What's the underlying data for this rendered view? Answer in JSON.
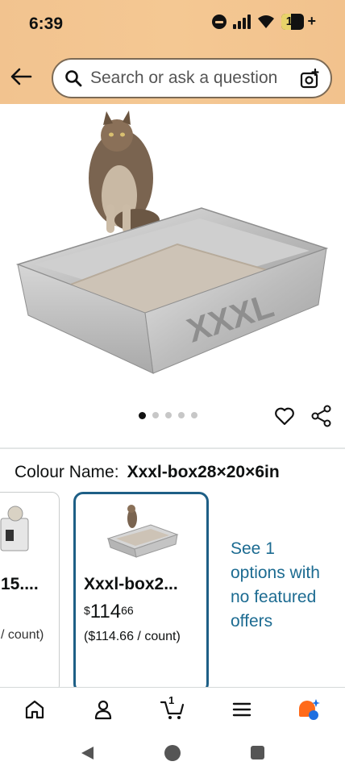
{
  "status_bar": {
    "time": "6:39",
    "battery": "14"
  },
  "search": {
    "placeholder": "Search or ask a question"
  },
  "product": {
    "image_text": "XXXL",
    "carousel": {
      "total": 5,
      "active": 1
    }
  },
  "colour": {
    "label": "Colour Name:",
    "value": "Xxxl-box28×20×6in"
  },
  "variants": [
    {
      "title": "15....",
      "unit_price": "/ count)"
    },
    {
      "title": "Xxxl-box2...",
      "currency": "$",
      "price_whole": "114",
      "price_fraction": "66",
      "unit_price": "($114.66 / count)",
      "selected": true
    }
  ],
  "see_options": "See 1 options with no featured offers",
  "bottom_nav": {
    "cart_count": "1"
  },
  "colors": {
    "header": "#f3c590",
    "accent_link": "#1c6b91",
    "selected_border": "#1e5f86"
  }
}
